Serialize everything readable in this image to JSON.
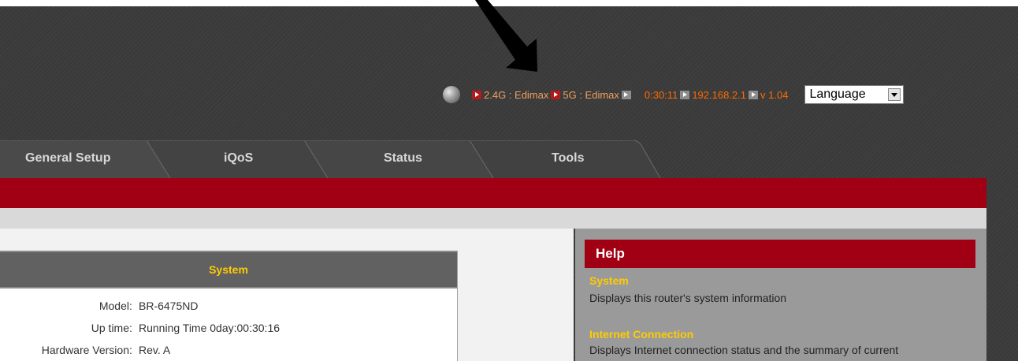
{
  "status_bar": {
    "wifi_24g": "2.4G : Edimax",
    "wifi_5g": "5G : Edimax",
    "time": "0:30:11",
    "ip": "192.168.2.1",
    "version": "v 1.04",
    "language_label": "Language"
  },
  "tabs": [
    {
      "label": "General Setup"
    },
    {
      "label": "iQoS"
    },
    {
      "label": "Status"
    },
    {
      "label": "Tools"
    }
  ],
  "system": {
    "title": "System",
    "rows": [
      {
        "label": "Model",
        "value": "BR-6475ND"
      },
      {
        "label": "Up time",
        "value": "Running Time 0day:00:30:16"
      },
      {
        "label": "Hardware Version",
        "value": "Rev. A"
      }
    ]
  },
  "help": {
    "title": "Help",
    "sections": [
      {
        "heading": "System",
        "text": "Displays this router's system information"
      },
      {
        "heading": "Internet Connection",
        "text": "Displays Internet connection status and the summary of current"
      }
    ]
  },
  "colors": {
    "brand_red": "#a10014",
    "highlight_yellow": "#ffcc00",
    "status_orange": "#ff6a00",
    "header_dark": "#3a3a3a"
  },
  "icons": [
    "arrow-annotation-icon",
    "globe-icon",
    "play-arrow-icon",
    "dropdown-arrow-icon"
  ]
}
